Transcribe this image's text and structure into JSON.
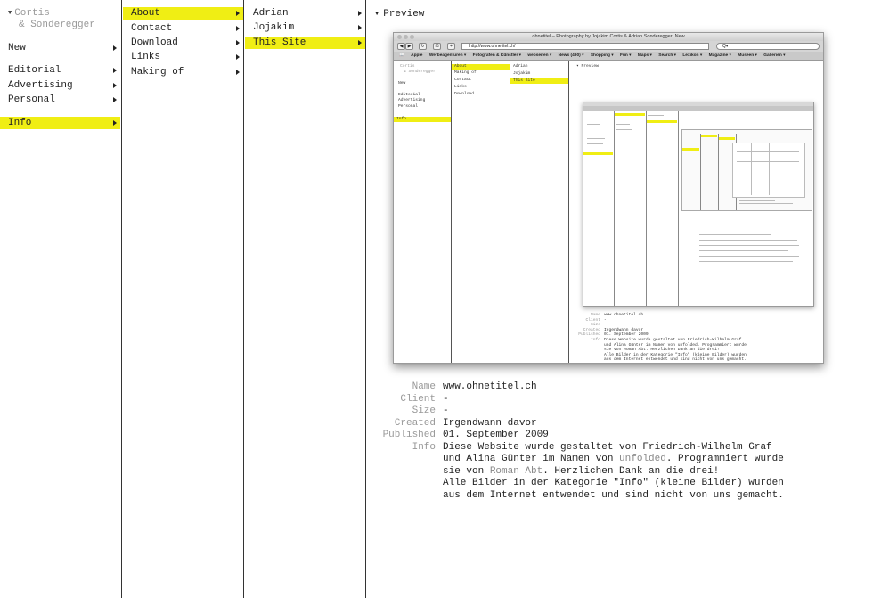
{
  "brand": {
    "line1": "Cortis",
    "line2": "& Sonderegger"
  },
  "col1": {
    "items": [
      {
        "label": "New"
      },
      {
        "label": "Editorial"
      },
      {
        "label": "Advertising"
      },
      {
        "label": "Personal"
      },
      {
        "label": "Info"
      }
    ]
  },
  "col2": {
    "items": [
      {
        "label": "About"
      },
      {
        "label": "Contact"
      },
      {
        "label": "Download"
      },
      {
        "label": "Links"
      },
      {
        "label": "Making of"
      }
    ]
  },
  "col3": {
    "items": [
      {
        "label": "Adrian"
      },
      {
        "label": "Jojakim"
      },
      {
        "label": "This Site"
      }
    ]
  },
  "preview": {
    "heading": "Preview",
    "browser": {
      "window_title": "ohnetitel – Photography by Jojakim Cortis & Adrian Sonderegger: New",
      "url": "http://www.ohnetitel.ch/",
      "search_placeholder": "Q▾",
      "bookmarks": [
        "Apple",
        "Werbeagenturen ▾",
        "Fotografen & Künstler ▾",
        "webseiten ▾",
        "News (490) ▾",
        "Shopping ▾",
        "Fun ▾",
        "Maps ▾",
        "Search ▾",
        "Lexikon ▾",
        "Magazine ▾",
        "Museen ▾",
        "Gallerien ▾"
      ]
    }
  },
  "details": {
    "name_label": "Name",
    "name_value": "www.ohnetitel.ch",
    "client_label": "Client",
    "client_value": "-",
    "size_label": "Size",
    "size_value": "-",
    "created_label": "Created",
    "created_value": "Irgendwann davor",
    "published_label": "Published",
    "published_value": "01. September 2009",
    "info_label": "Info",
    "info_line1": "Diese Website wurde gestaltet von Friedrich-Wilhelm Graf",
    "info_line2_pre": "und Alina Günter im Namen von ",
    "info_line2_link": "unfolded",
    "info_line2_post": ". Programmiert wurde",
    "info_line3_pre": "sie von ",
    "info_line3_link": "Roman Abt",
    "info_line3_post": ". Herzlichen Dank an die drei!",
    "info_line4": "Alle Bilder in der Kategorie \"Info\" (kleine Bilder) wurden",
    "info_line5": "aus dem Internet entwendet und sind nicht von uns gemacht."
  },
  "colors": {
    "highlight": "#f0ee14",
    "muted_text": "#999999",
    "divider": "#333333"
  }
}
